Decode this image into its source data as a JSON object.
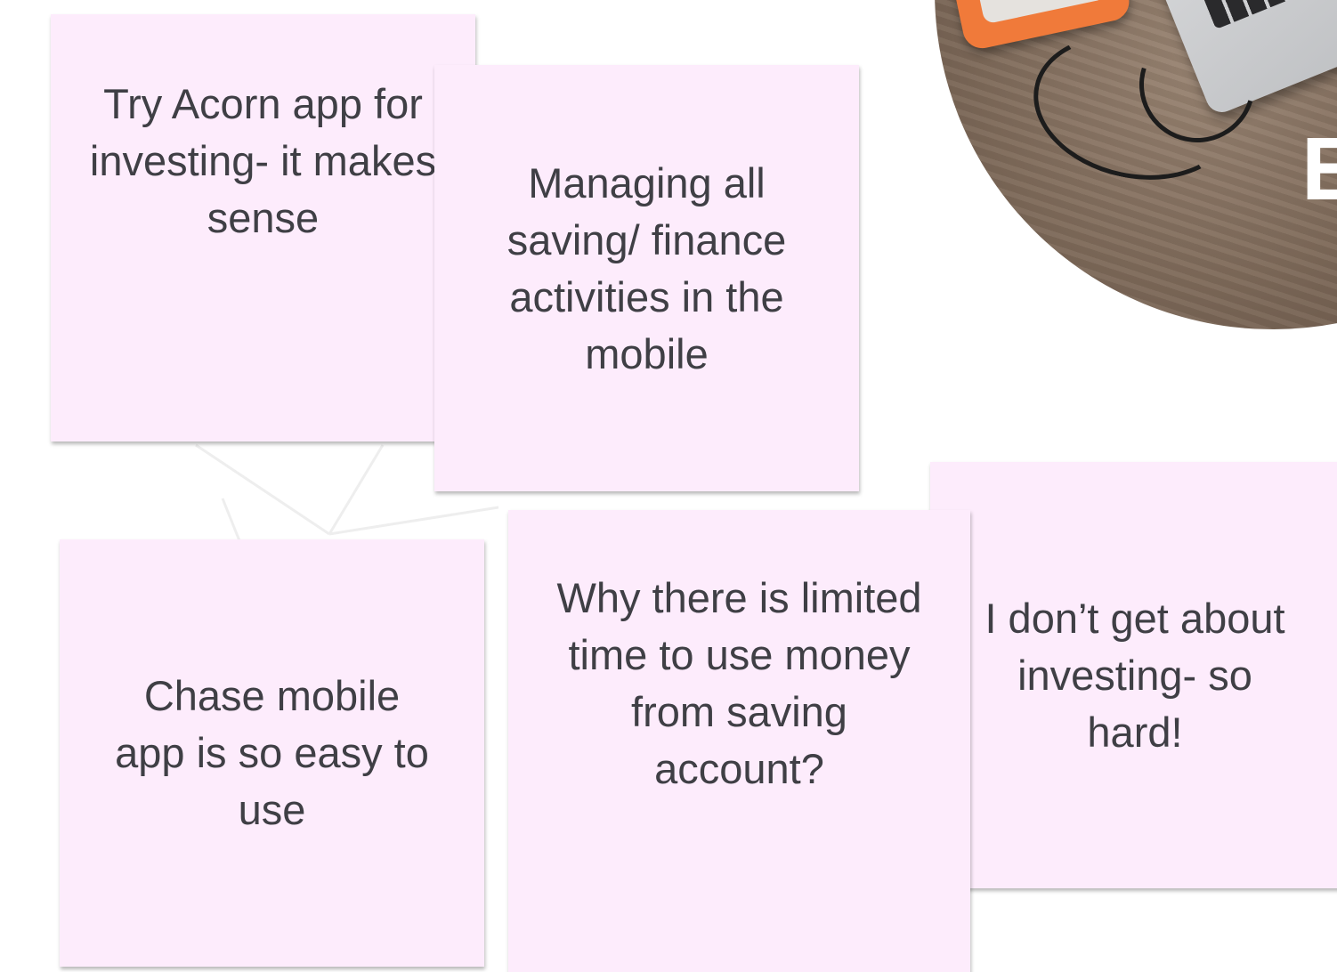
{
  "photo": {
    "edge_text": "E"
  },
  "notes": [
    {
      "text": "Try Acorn app for investing- it makes sense"
    },
    {
      "text": "Managing all saving/ finance activities in the mobile"
    },
    {
      "text": "Chase mobile app is so easy to use"
    },
    {
      "text": "Why there is limited time to use money from saving account?"
    },
    {
      "text": "I don’t get about investing- so hard!"
    }
  ],
  "colors": {
    "sticky_bg": "#fdecfc",
    "text": "#3f3f45"
  }
}
